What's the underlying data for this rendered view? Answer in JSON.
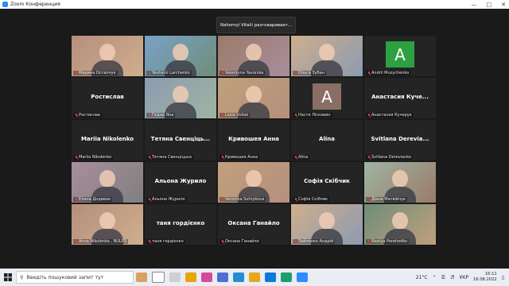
{
  "window": {
    "title": "Zoom Конференция"
  },
  "speaker_banner": {
    "text": "Nahornyi Vitalii разговаривает..."
  },
  "tiles": [
    {
      "caption": "Марина Остапчук",
      "kind": "video",
      "muted": true
    },
    {
      "caption": "Yevhenii Larchenko",
      "kind": "video",
      "muted": true
    },
    {
      "caption": "Valentyna Yavorska",
      "kind": "video",
      "muted": true
    },
    {
      "caption": "Ольга Зубан",
      "kind": "video",
      "muted": true
    },
    {
      "caption": "Andrii Muzychenko",
      "kind": "letter",
      "letter": "A",
      "color": "#2ea043",
      "muted": true
    },
    {
      "caption": "Ростислав",
      "kind": "name",
      "bigname": "Ростислав",
      "muted": true
    },
    {
      "caption": "Гедна Яна",
      "kind": "video",
      "muted": true
    },
    {
      "caption": "Lesia Voliak",
      "kind": "video",
      "muted": true
    },
    {
      "caption": "Настя Лісковин",
      "kind": "letter",
      "letter": "A",
      "color": "#8a6e63",
      "muted": true
    },
    {
      "caption": "Анастасия Кучерук",
      "kind": "name",
      "bigname": "Анастасия Куче...",
      "muted": true
    },
    {
      "caption": "Mariia Nikolenko",
      "kind": "name",
      "bigname": "Mariia Nikolenko",
      "muted": true
    },
    {
      "caption": "Тетяна Свенціцька",
      "kind": "name",
      "bigname": "Тетяна Свенціць...",
      "muted": true
    },
    {
      "caption": "Кривошея Анна",
      "kind": "name",
      "bigname": "Кривошея Анна",
      "muted": true
    },
    {
      "caption": "Alina",
      "kind": "name",
      "bigname": "Alina",
      "muted": true
    },
    {
      "caption": "Svitlana Derevianko",
      "kind": "name",
      "bigname": "Svitlana Derevia...",
      "muted": true
    },
    {
      "caption": "Елена Додиван",
      "kind": "video",
      "muted": true
    },
    {
      "caption": "Альона Журило",
      "kind": "name",
      "bigname": "Альона Журило",
      "muted": true
    },
    {
      "caption": "Veronika Sotnykova",
      "kind": "video",
      "muted": true
    },
    {
      "caption": "Софія Скібчик",
      "kind": "name",
      "bigname": "Софія Скібчик",
      "muted": true
    },
    {
      "caption": "Діана Матвійчук",
      "kind": "video",
      "muted": true
    },
    {
      "caption": "Anna Nikolenko , NULES",
      "kind": "video",
      "muted": true
    },
    {
      "caption": "таня гордієнко",
      "kind": "name",
      "bigname": "таня гордієнко",
      "muted": true
    },
    {
      "caption": "Оксана Ганайло",
      "kind": "name",
      "bigname": "Оксана Ганайло",
      "muted": true
    },
    {
      "caption": "Зайченко Андрій",
      "kind": "video",
      "muted": true
    },
    {
      "caption": "Nastya Perehodko",
      "kind": "video",
      "muted": true
    }
  ],
  "taskbar": {
    "search_placeholder": "Введіть пошуковий запит тут",
    "temperature": "21°C",
    "language": "УКР",
    "time": "16:11",
    "date": "16.08.2022"
  }
}
